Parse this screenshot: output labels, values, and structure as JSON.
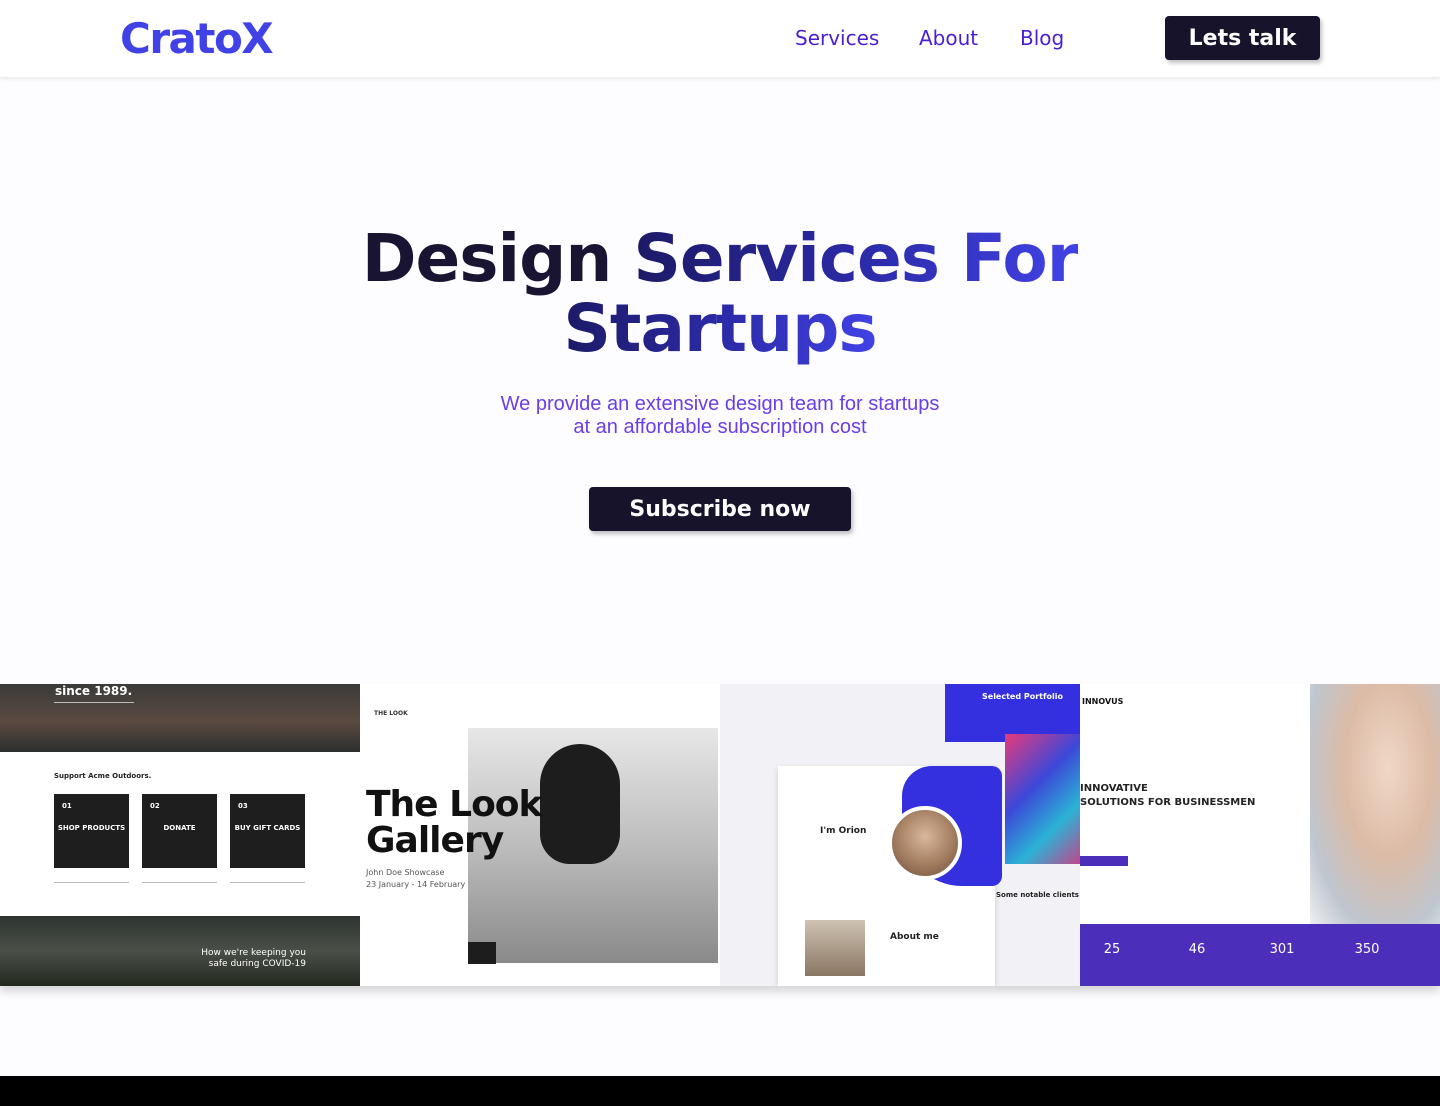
{
  "header": {
    "logo": "CratoX",
    "nav": [
      "Services",
      "About",
      "Blog"
    ],
    "cta": "Lets talk"
  },
  "hero": {
    "title_part1": "Design",
    "title_part2": "Services For",
    "title_part3": "Startups",
    "subtitle_line1": "We provide an extensive design team for startups",
    "subtitle_line2": "at an affordable subscription cost",
    "button": "Subscribe now"
  },
  "gallery": {
    "card1": {
      "top_text": "since 1989.",
      "support": "Support Acme Outdoors.",
      "boxes": [
        {
          "num": "01",
          "label": "SHOP PRODUCTS"
        },
        {
          "num": "02",
          "label": "DONATE"
        },
        {
          "num": "03",
          "label": "BUY GIFT CARDS"
        }
      ],
      "bottom_text": "How we're keeping you safe during COVID-19"
    },
    "card2": {
      "brand": "THE LOOK",
      "title_line1": "The Look",
      "title_line2": "Gallery",
      "sub_line1": "John Doe Showcase",
      "sub_line2": "23 January - 14 February"
    },
    "card3": {
      "portfolio": "Selected Portfolio",
      "greeting": "I'm Orion",
      "about": "About me",
      "clients": "Some notable clients"
    },
    "card4": {
      "brand": "INNOVUS",
      "headline_line1": "INNOVATIVE",
      "headline_line2": "SOLUTIONS FOR BUSINESSMEN",
      "stats": [
        "25",
        "46",
        "301",
        "350"
      ]
    }
  },
  "colors": {
    "brand": "#4142e6",
    "nav": "#4a1fd4",
    "dark_button": "#16132b",
    "subtitle": "#6a3ee8"
  }
}
